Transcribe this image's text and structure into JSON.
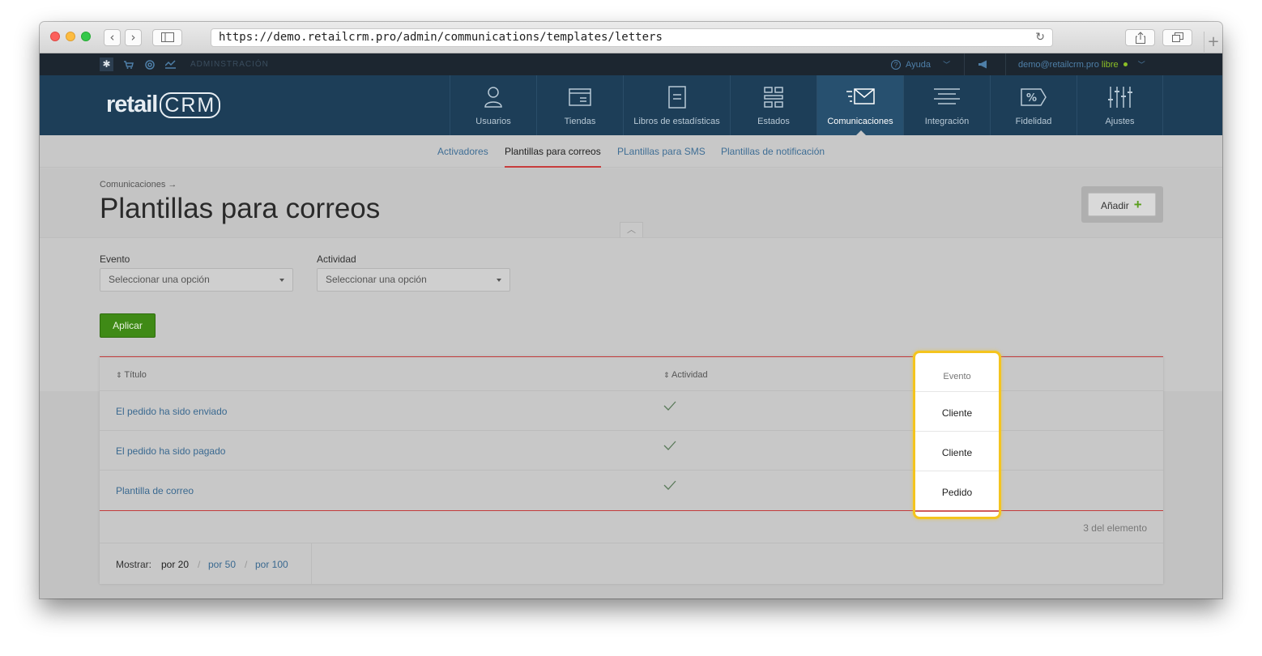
{
  "browser": {
    "url": "https://demo.retailcrm.pro/admin/communications/templates/letters"
  },
  "admin_bar": {
    "section_label": "ADMINSTRACIÓN",
    "help_label": "Ayuda",
    "user_email": "demo@retailcrm.pro",
    "plan_label": "libre"
  },
  "logo": {
    "text_left": "retail",
    "text_right": "CRM"
  },
  "main_nav": [
    {
      "label": "Usuarios",
      "icon": "user-icon"
    },
    {
      "label": "Tiendas",
      "icon": "store-window-icon"
    },
    {
      "label": "Libros de estadísticas",
      "icon": "book-icon"
    },
    {
      "label": "Estados",
      "icon": "status-grid-icon"
    },
    {
      "label": "Comunicaciones",
      "icon": "envelope-icon",
      "active": true
    },
    {
      "label": "Integración",
      "icon": "integration-lines-icon"
    },
    {
      "label": "Fidelidad",
      "icon": "percent-tag-icon"
    },
    {
      "label": "Ajustes",
      "icon": "sliders-icon"
    }
  ],
  "sub_nav": [
    {
      "label": "Activadores"
    },
    {
      "label": "Plantillas para correos",
      "active": true
    },
    {
      "label": "PLantillas para SMS"
    },
    {
      "label": "Plantillas de notificación"
    }
  ],
  "page": {
    "breadcrumb": "Comunicaciones →",
    "title": "Plantillas para correos",
    "add_button": "Añadir",
    "add_icon": "+"
  },
  "filters": {
    "event_label": "Evento",
    "event_placeholder": "Seleccionar una opción",
    "activity_label": "Actividad",
    "activity_placeholder": "Seleccionar una opción",
    "apply_button": "Aplicar"
  },
  "table": {
    "columns": [
      "Título",
      "Actividad",
      "Evento"
    ],
    "rows": [
      {
        "title": "El pedido ha sido enviado",
        "active": true,
        "event": "Cliente"
      },
      {
        "title": "El pedido ha sido pagado",
        "active": true,
        "event": "Cliente"
      },
      {
        "title": "Plantilla de correo",
        "active": true,
        "event": "Pedido"
      }
    ],
    "count_text": "3 del elemento"
  },
  "pagination": {
    "label": "Mostrar:",
    "options": [
      "por 20",
      "por 50",
      "por 100"
    ],
    "separator": "/"
  },
  "colors": {
    "nav_bg": "#1d3e58",
    "admin_bar_bg": "#1c2630",
    "accent_red": "#c33c3c",
    "apply_green": "#3f8a16",
    "highlight_yellow": "#f4c41e"
  }
}
